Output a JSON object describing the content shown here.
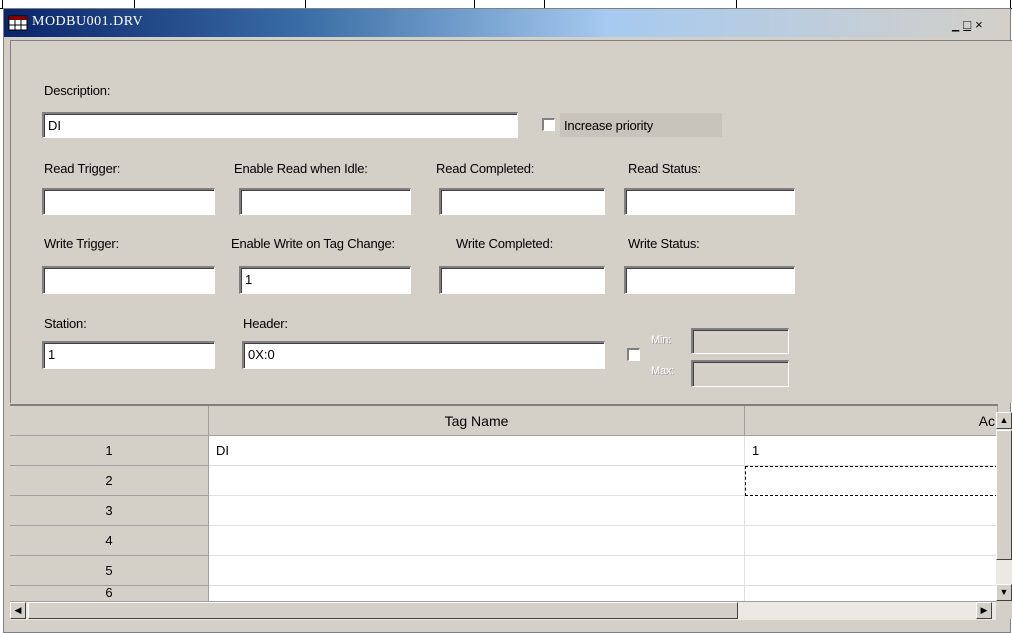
{
  "window": {
    "title": "MODBU001.DRV"
  },
  "form": {
    "description_label": "Description:",
    "description_value": "DI",
    "increase_priority_label": "Increase priority",
    "read_trigger_label": "Read Trigger:",
    "enable_read_label": "Enable Read when Idle:",
    "read_completed_label": "Read Completed:",
    "read_status_label": "Read Status:",
    "read_trigger_value": "",
    "enable_read_value": "",
    "read_completed_value": "",
    "read_status_value": "",
    "write_trigger_label": "Write Trigger:",
    "enable_write_label": "Enable Write on Tag Change:",
    "write_completed_label": "Write Completed:",
    "write_status_label": "Write Status:",
    "write_trigger_value": "",
    "enable_write_value": "1",
    "write_completed_value": "",
    "write_status_value": "",
    "station_label": "Station:",
    "station_value": "1",
    "header_label": "Header:",
    "header_value": "0X:0",
    "min_label": "Min:",
    "max_label": "Max:",
    "min_value": "",
    "max_value": ""
  },
  "grid": {
    "columns": [
      "Tag Name",
      "Ac"
    ],
    "rows": [
      {
        "num": "1",
        "tag": "DI",
        "addr": "1"
      },
      {
        "num": "2",
        "tag": "",
        "addr": ""
      },
      {
        "num": "3",
        "tag": "",
        "addr": ""
      },
      {
        "num": "4",
        "tag": "",
        "addr": ""
      },
      {
        "num": "5",
        "tag": "",
        "addr": ""
      },
      {
        "num": "6",
        "tag": "",
        "addr": ""
      }
    ]
  },
  "icons": {
    "app_icon": "grid-app-icon",
    "scroll_up": "arrow-up-icon",
    "scroll_down": "arrow-down-icon",
    "scroll_left": "arrow-left-icon",
    "scroll_right": "arrow-right-icon"
  },
  "titlebar_buttons": {
    "minimize": "_",
    "maximize": "□",
    "close": "×"
  },
  "colors": {
    "titlebar": "#0a246a",
    "face": "#d4d0c8"
  }
}
